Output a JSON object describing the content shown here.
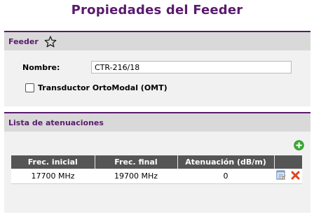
{
  "page": {
    "title": "Propiedades del Feeder"
  },
  "feeder": {
    "header": "Feeder",
    "star_icon": "star-outline-icon",
    "name_label": "Nombre:",
    "name_value": "CTR-216/18",
    "omt_label": "Transductor OrtoModal (OMT)",
    "omt_checked": false
  },
  "attenuations": {
    "header": "Lista de atenuaciones",
    "add_icon": "plus-circle-icon",
    "columns": [
      "Frec. inicial",
      "Frec. final",
      "Atenuación (dB/m)",
      ""
    ],
    "rows": [
      {
        "start": "17700 MHz",
        "end": "19700 MHz",
        "attenuation": "0",
        "edit_icon": "edit-icon",
        "delete_icon": "delete-icon"
      }
    ]
  },
  "colors": {
    "accent": "#5a1a6e",
    "header_bg": "#d9d9d9",
    "table_header": "#555555",
    "add_green": "#3aaa35",
    "delete_red": "#e0431f"
  }
}
